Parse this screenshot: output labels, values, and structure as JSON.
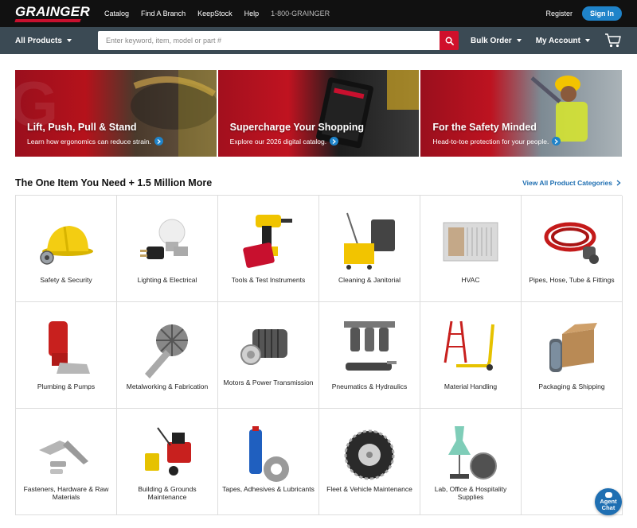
{
  "header": {
    "logo": "GRAINGER",
    "links": [
      "Catalog",
      "Find A Branch",
      "KeepStock",
      "Help"
    ],
    "phone": "1-800-GRAINGER",
    "register": "Register",
    "sign_in": "Sign In"
  },
  "nav": {
    "all_products": "All Products",
    "search_placeholder": "Enter keyword, item, model or part #",
    "bulk_order": "Bulk Order",
    "my_account": "My Account"
  },
  "banners": [
    {
      "title": "Lift, Push, Pull & Stand",
      "subtitle": "Learn how ergonomics can reduce strain."
    },
    {
      "title": "Supercharge Your Shopping",
      "subtitle": "Explore our 2026 digital catalog."
    },
    {
      "title": "For the Safety Minded",
      "subtitle": "Head-to-toe protection for your people."
    }
  ],
  "section": {
    "title": "The One Item You Need + 1.5 Million More",
    "view_all": "View All Product Categories"
  },
  "categories": [
    {
      "label": "Safety & Security",
      "icon": "hard-hat-icon"
    },
    {
      "label": "Lighting & Electrical",
      "icon": "light-bulb-icon"
    },
    {
      "label": "Tools & Test Instruments",
      "icon": "drill-icon"
    },
    {
      "label": "Cleaning & Janitorial",
      "icon": "mop-bucket-icon"
    },
    {
      "label": "HVAC",
      "icon": "air-conditioner-icon"
    },
    {
      "label": "Pipes, Hose, Tube & Fittings",
      "icon": "hose-icon"
    },
    {
      "label": "Plumbing & Pumps",
      "icon": "pump-icon"
    },
    {
      "label": "Metalworking & Fabrication",
      "icon": "flap-disc-icon"
    },
    {
      "label": "Motors & Power Transmission",
      "icon": "motor-icon"
    },
    {
      "label": "Pneumatics & Hydraulics",
      "icon": "pneumatic-icon"
    },
    {
      "label": "Material Handling",
      "icon": "pallet-jack-icon"
    },
    {
      "label": "Packaging & Shipping",
      "icon": "box-icon"
    },
    {
      "label": "Fasteners, Hardware & Raw Materials",
      "icon": "bolt-icon"
    },
    {
      "label": "Building & Grounds Maintenance",
      "icon": "snowblower-icon"
    },
    {
      "label": "Tapes, Adhesives & Lubricants",
      "icon": "tape-icon"
    },
    {
      "label": "Fleet & Vehicle Maintenance",
      "icon": "tire-chain-icon"
    },
    {
      "label": "Lab, Office & Hospitality Supplies",
      "icon": "lab-flask-icon"
    }
  ],
  "chat": {
    "line1": "Agent",
    "line2": "Chat"
  },
  "colors": {
    "brand_red": "#c8102e",
    "accent_blue": "#1f83c9",
    "nav_gray": "#3b4a54"
  }
}
